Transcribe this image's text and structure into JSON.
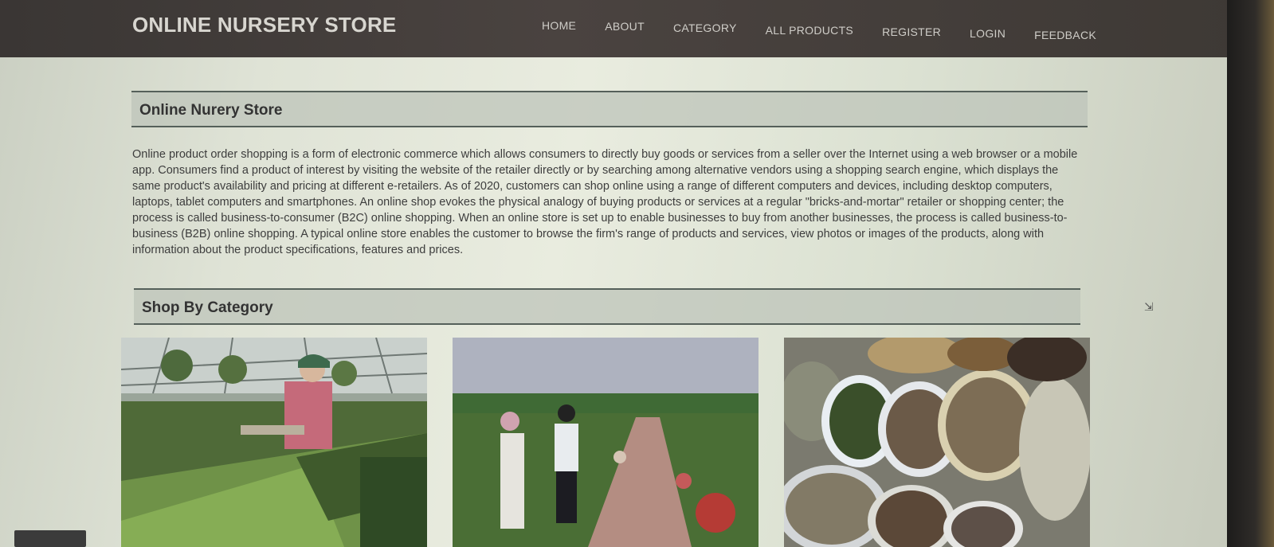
{
  "header": {
    "brand": "ONLINE NURSERY STORE",
    "nav": [
      "HOME",
      "ABOUT",
      "CATEGORY",
      "ALL PRODUCTS",
      "REGISTER",
      "LOGIN",
      "FEEDBACK"
    ]
  },
  "main": {
    "section_title": "Online Nurery Store",
    "intro_text": "Online product order shopping is a form of electronic commerce which allows consumers to directly buy goods or services from a seller over the Internet using a web browser or a mobile app. Consumers find a product of interest by visiting the website of the retailer directly or by searching among alternative vendors using a shopping search engine, which displays the same product's availability and pricing at different e-retailers. As of 2020, customers can shop online using a range of different computers and devices, including desktop computers, laptops, tablet computers and smartphones. An online shop evokes the physical analogy of buying products or services at a regular \"bricks-and-mortar\" retailer or shopping center; the process is called business-to-consumer (B2C) online shopping. When an online store is set up to enable businesses to buy from another businesses, the process is called business-to-business (B2B) online shopping. A typical online store enables the customer to browse the firm's range of products and services, view photos or images of the products, along with information about the product specifications, features and prices.",
    "category_title": "Shop By Category"
  },
  "colors": {
    "header_bg": "#3e3935",
    "page_bg": "#dfe3d6",
    "section_head_bg": "#bec4ba",
    "text": "#3d3d3d"
  }
}
